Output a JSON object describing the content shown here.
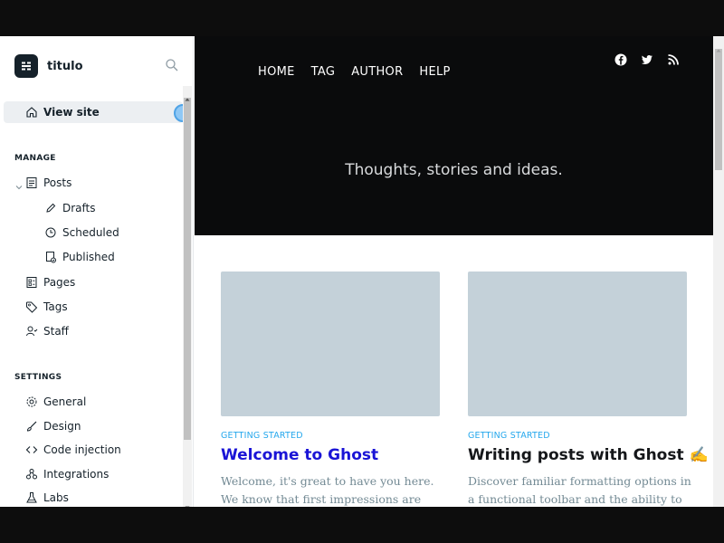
{
  "sidebar": {
    "brand": "titulo",
    "view_site": "View site",
    "manage_heading": "MANAGE",
    "posts": "Posts",
    "drafts": "Drafts",
    "scheduled": "Scheduled",
    "published": "Published",
    "pages": "Pages",
    "tags": "Tags",
    "staff": "Staff",
    "settings_heading": "SETTINGS",
    "general": "General",
    "design": "Design",
    "code_injection": "Code injection",
    "integrations": "Integrations",
    "labs": "Labs"
  },
  "site": {
    "nav": [
      "HOME",
      "TAG",
      "AUTHOR",
      "HELP"
    ],
    "social_icons": [
      "facebook-icon",
      "twitter-icon",
      "rss-icon"
    ],
    "tagline": "Thoughts, stories and ideas."
  },
  "posts": [
    {
      "tag": "GETTING STARTED",
      "title": "Welcome to Ghost",
      "excerpt": "Welcome, it's great to have you here. We know that first impressions are important, so we've"
    },
    {
      "tag": "GETTING STARTED",
      "title": "Writing posts with Ghost ✍️",
      "excerpt": "Discover familiar formatting options in a functional toolbar and the ability to add"
    }
  ],
  "colors": {
    "accent": "#26a8ed",
    "link_title": "#1a14d6",
    "hero_bg": "#0a0b0c",
    "image_placeholder": "#c4d1d9"
  }
}
